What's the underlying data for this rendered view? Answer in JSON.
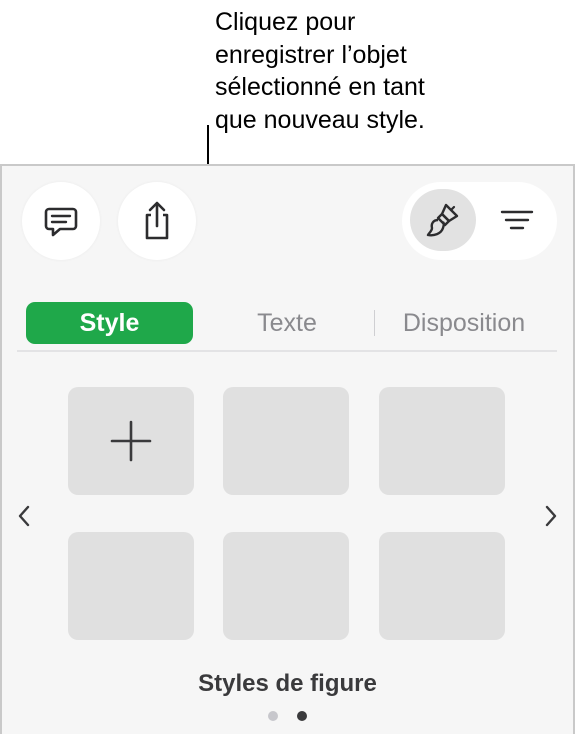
{
  "callout": {
    "lines": [
      "Cliquez pour",
      "enregistrer l’objet",
      "sélectionné en tant",
      "que nouveau style."
    ]
  },
  "toolbar": {
    "comment_icon": "comment-bubble-icon",
    "share_icon": "share-icon",
    "format_icon": "paintbrush-icon",
    "document_options_icon": "menu-lines-icon"
  },
  "tabs": [
    {
      "label": "Style",
      "selected": true
    },
    {
      "label": "Texte",
      "selected": false
    },
    {
      "label": "Disposition",
      "selected": false
    }
  ],
  "style_grid": {
    "add_icon": "plus-icon",
    "prev_icon": "chevron-left-icon",
    "next_icon": "chevron-right-icon",
    "caption": "Styles de figure",
    "page_count": 2,
    "current_page": 2
  },
  "colors": {
    "accent": "#1fa84a",
    "tile": "#e0e0e0",
    "panel": "#f6f6f6"
  }
}
